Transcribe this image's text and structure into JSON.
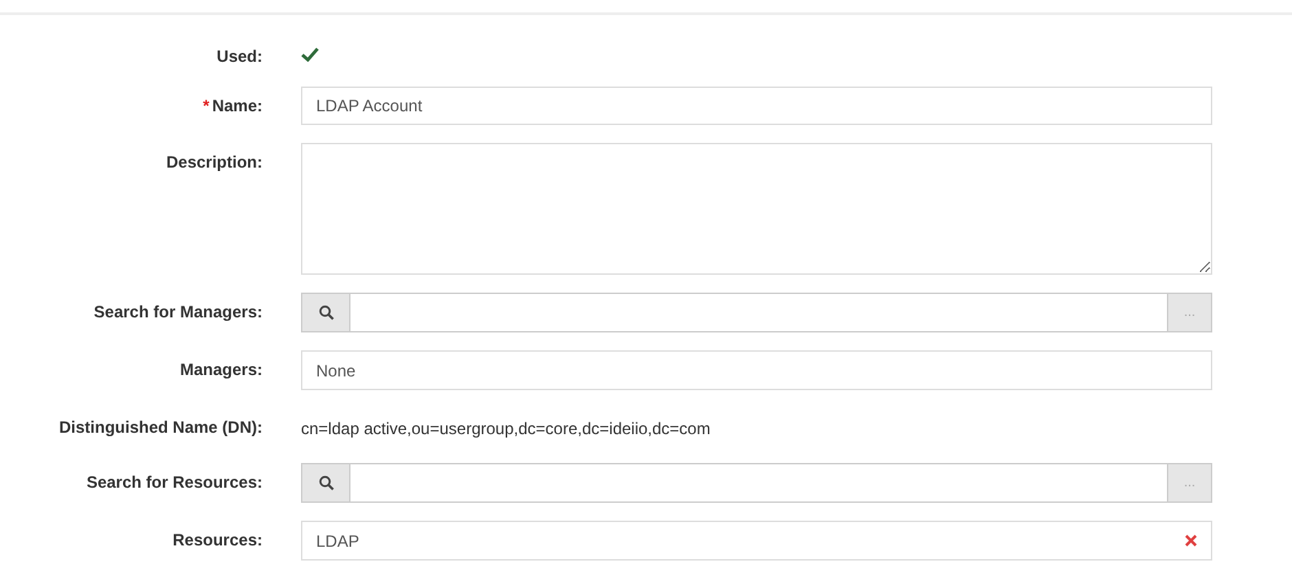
{
  "fields": [
    {
      "kind": "check",
      "label": "Used:",
      "checked": true
    },
    {
      "kind": "text",
      "label": "Name:",
      "required_mark": "*",
      "value": "LDAP Account"
    },
    {
      "kind": "textarea",
      "label": "Description:"
    },
    {
      "kind": "search",
      "label": "Search for Managers:",
      "button": "..."
    },
    {
      "kind": "list",
      "label": "Managers:",
      "value": "None"
    },
    {
      "kind": "static",
      "label": "Distinguished Name (DN):",
      "value": "cn=ldap active,ou=usergroup,dc=core,dc=ideiio,dc=com"
    },
    {
      "kind": "search",
      "label": "Search for Resources:",
      "button": "..."
    },
    {
      "kind": "tags",
      "label": "Resources:",
      "value": "LDAP",
      "removable": true
    }
  ]
}
